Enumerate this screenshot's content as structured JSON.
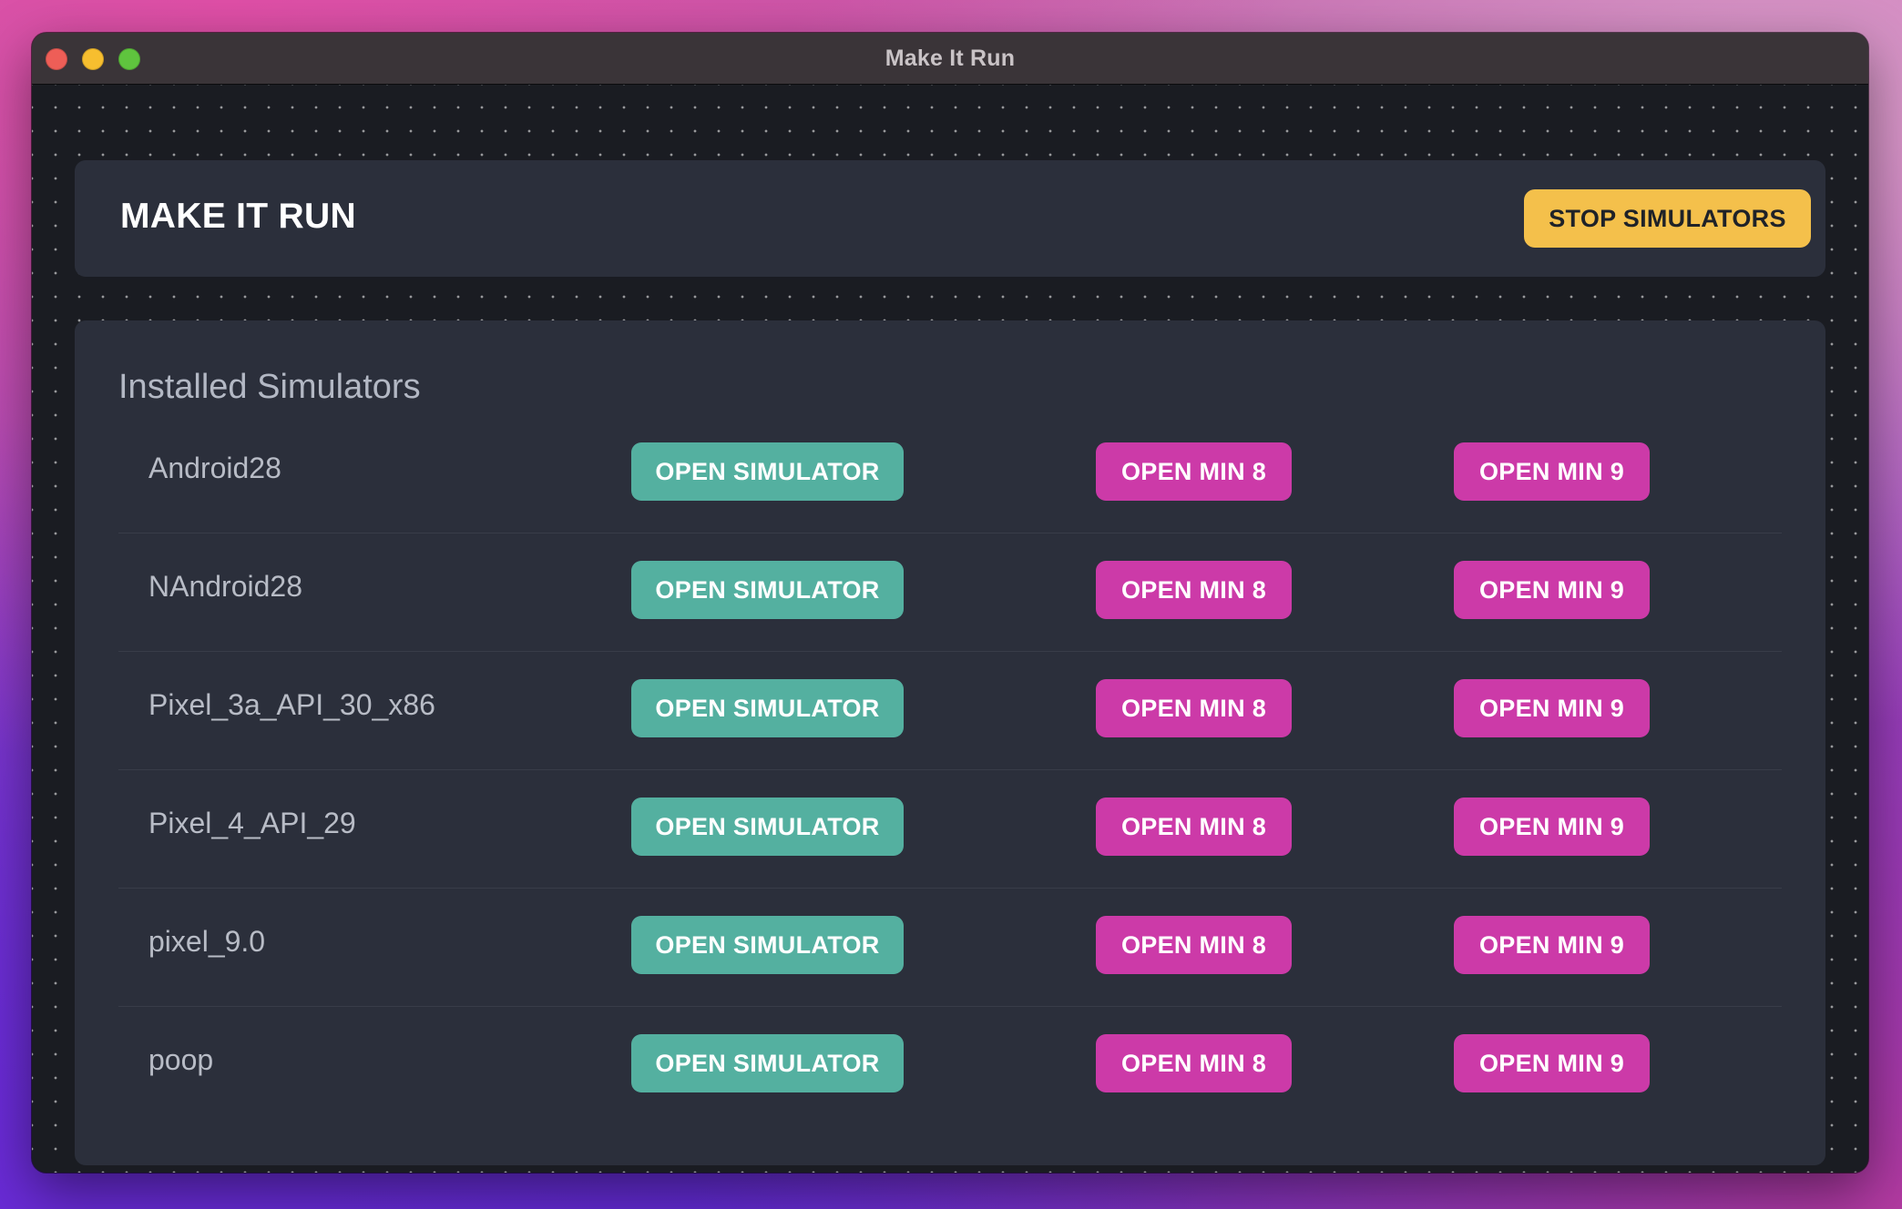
{
  "window": {
    "title": "Make It Run"
  },
  "header": {
    "app_title": "MAKE IT RUN",
    "stop_button": "STOP SIMULATORS"
  },
  "simulators": {
    "section_title": "Installed Simulators",
    "items": [
      {
        "name": "Android28",
        "open_label": "OPEN SIMULATOR",
        "min8_label": "OPEN MIN 8",
        "min9_label": "OPEN MIN 9"
      },
      {
        "name": "NAndroid28",
        "open_label": "OPEN SIMULATOR",
        "min8_label": "OPEN MIN 8",
        "min9_label": "OPEN MIN 9"
      },
      {
        "name": "Pixel_3a_API_30_x86",
        "open_label": "OPEN SIMULATOR",
        "min8_label": "OPEN MIN 8",
        "min9_label": "OPEN MIN 9"
      },
      {
        "name": "Pixel_4_API_29",
        "open_label": "OPEN SIMULATOR",
        "min8_label": "OPEN MIN 8",
        "min9_label": "OPEN MIN 9"
      },
      {
        "name": "pixel_9.0",
        "open_label": "OPEN SIMULATOR",
        "min8_label": "OPEN MIN 8",
        "min9_label": "OPEN MIN 9"
      },
      {
        "name": "poop",
        "open_label": "OPEN SIMULATOR",
        "min8_label": "OPEN MIN 8",
        "min9_label": "OPEN MIN 9"
      }
    ]
  },
  "colors": {
    "accent_yellow": "#f4c04b",
    "accent_teal": "#54b0a0",
    "accent_magenta": "#cc3aa8",
    "card_bg": "#2b2f3b",
    "window_bg": "#1a1c22"
  }
}
